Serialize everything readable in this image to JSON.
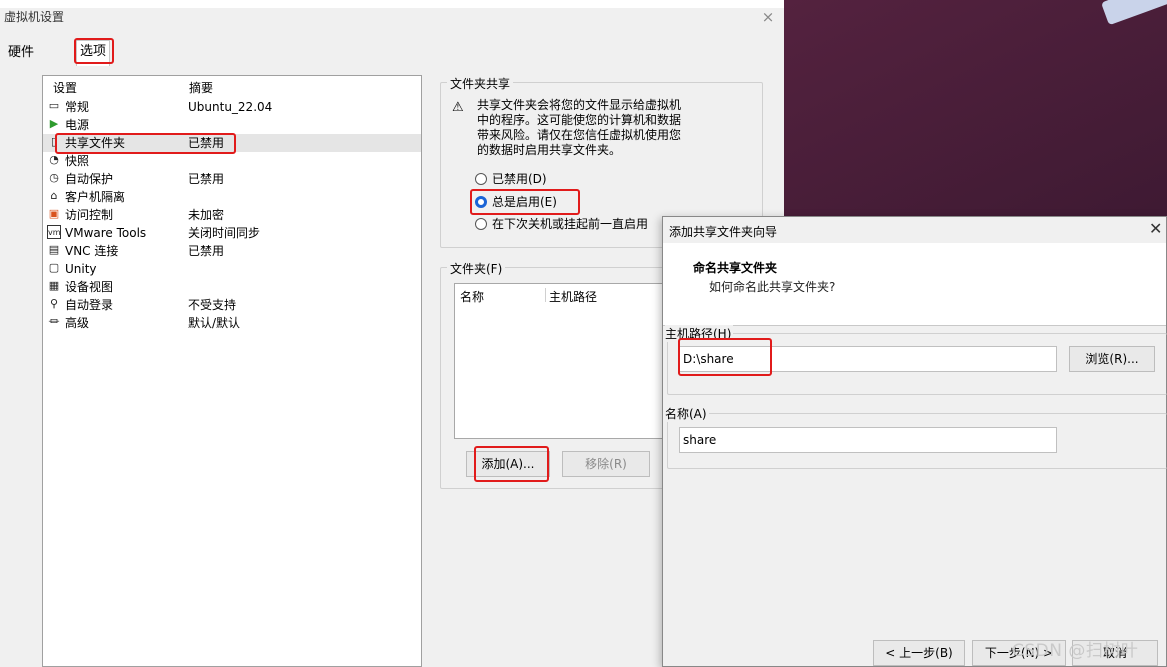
{
  "main_window": {
    "title": "虚拟机设置",
    "close_glyph": "×",
    "tabs": [
      "硬件",
      "选项"
    ],
    "list": {
      "header_setting": "设置",
      "header_summary": "摘要",
      "items": [
        {
          "icon": "monitor-icon",
          "glyph": "▭",
          "name": "常规",
          "summary": "Ubuntu_22.04"
        },
        {
          "icon": "power-icon",
          "glyph": "▶",
          "name": "电源",
          "summary": ""
        },
        {
          "icon": "shared-folder-icon",
          "glyph": "▯",
          "name": "共享文件夹",
          "summary": "已禁用"
        },
        {
          "icon": "snapshot-icon",
          "glyph": "◔",
          "name": "快照",
          "summary": ""
        },
        {
          "icon": "autoprotect-icon",
          "glyph": "◷",
          "name": "自动保护",
          "summary": "已禁用"
        },
        {
          "icon": "isolation-icon",
          "glyph": "⌂",
          "name": "客户机隔离",
          "summary": ""
        },
        {
          "icon": "access-control-icon",
          "glyph": "▣",
          "name": "访问控制",
          "summary": "未加密"
        },
        {
          "icon": "vmware-tools-icon",
          "glyph": "vm",
          "name": "VMware Tools",
          "summary": "关闭时间同步"
        },
        {
          "icon": "vnc-icon",
          "glyph": "▤",
          "name": "VNC 连接",
          "summary": "已禁用"
        },
        {
          "icon": "unity-icon",
          "glyph": "▢",
          "name": "Unity",
          "summary": ""
        },
        {
          "icon": "device-view-icon",
          "glyph": "▦",
          "name": "设备视图",
          "summary": ""
        },
        {
          "icon": "autologin-icon",
          "glyph": "⚲",
          "name": "自动登录",
          "summary": "不受支持"
        },
        {
          "icon": "advanced-icon",
          "glyph": "⏛",
          "name": "高级",
          "summary": "默认/默认"
        }
      ]
    },
    "sharing": {
      "group_label": "文件夹共享",
      "warning": "共享文件夹会将您的文件显示给虚拟机中的程序。这可能会使您的计算机和数据带来风险。请仅在您信任虚拟机使用您的数据时启用共享文件夹。",
      "warning_lines": [
        "共享文件夹会将您的文件显示给虚拟机",
        "中的程序。这可能使您的计算机和数据",
        "带来风险。请仅在您信任虚拟机使用您",
        "的数据时启用共享文件夹。"
      ],
      "options": [
        "已禁用(D)",
        "总是启用(E)",
        "在下次关机或挂起前一直启用"
      ],
      "selected_option": "总是启用(E)"
    },
    "folders": {
      "group_label": "文件夹(F)",
      "col_name": "名称",
      "col_path": "主机路径",
      "add_button": "添加(A)...",
      "remove_button": "移除(R)"
    }
  },
  "wizard": {
    "title": "添加共享文件夹向导",
    "close_glyph": "✕",
    "heading": "命名共享文件夹",
    "subheading": "如何命名此共享文件夹?",
    "host_path_label": "主机路径(H)",
    "host_path_value": "D:\\share",
    "browse_button": "浏览(R)...",
    "name_label": "名称(A)",
    "name_value": "share",
    "back_button": "< 上一步(B)",
    "next_button": "下一步(N) >",
    "cancel_button": "取消"
  },
  "watermark": "CSDN @扫树叶",
  "colors": {
    "highlight": "#e11b1b",
    "radio_on": "#1b64d6",
    "desktop": "#4a1d39"
  }
}
